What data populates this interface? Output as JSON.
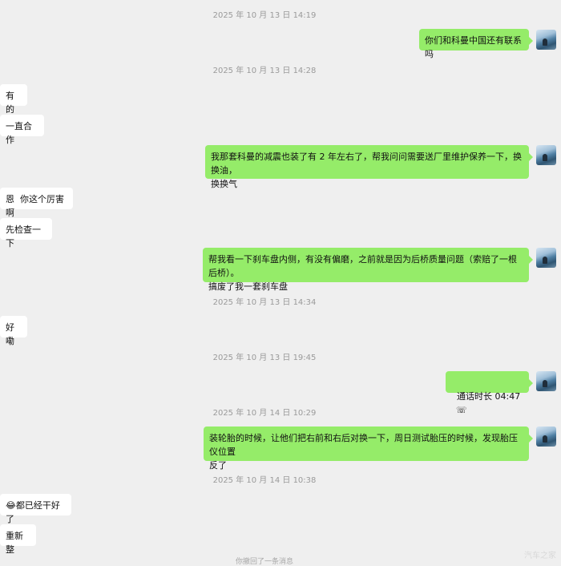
{
  "timestamps": [
    "2025 年 10 月 13 日 14:19",
    "2025 年 10 月 13 日 14:28",
    "2025 年 10 月 13 日 14:34",
    "2025 年 10 月 13 日 19:45",
    "2025 年 10 月 14 日 10:29",
    "2025 年 10 月 14 日 10:38"
  ],
  "messages": {
    "m1": "你们和科曼中国还有联系吗",
    "m2": "有的",
    "m3": "一直合作",
    "m4": "我那套科曼的减震也装了有 2 年左右了，帮我问问需要送厂里维护保养一下，换换油，\n换换气",
    "m5": "恩  你这个厉害啊",
    "m6": "先检查一下",
    "m7": "帮我看一下刹车盘内侧，有没有偏磨，之前就是因为后桥质量问题（索赔了一根后桥）。\n搞废了我一套刹车盘",
    "m8": "好嘞",
    "m9_text": "通话时长 04:47",
    "m9_icon": "☏",
    "m10": "装轮胎的时候，让他们把右前和右后对换一下，周日测试胎压的时候，发现胎压仪位置\n反了",
    "m11": "😂都已经干好了",
    "m12": "重新整"
  },
  "recall_notice": "你撤回了一条消息",
  "watermark": "汽车之家"
}
